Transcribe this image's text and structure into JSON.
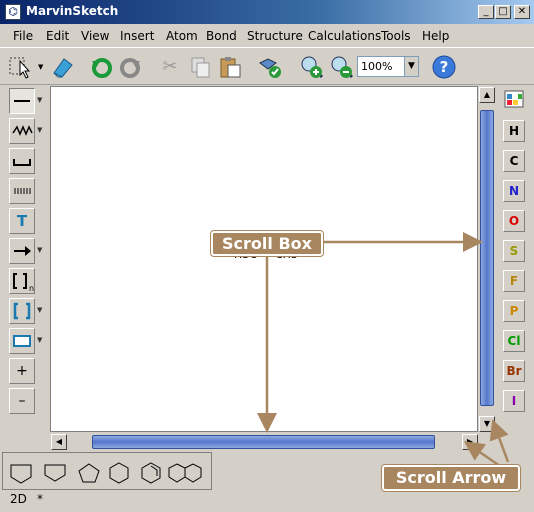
{
  "window": {
    "title": "MarvinSketch"
  },
  "menu": [
    "File",
    "Edit",
    "View",
    "Insert",
    "Atom",
    "Bond",
    "Structure",
    "Calculations",
    "Tools",
    "Help"
  ],
  "toolbar": {
    "zoom_value": "100%"
  },
  "canvas": {
    "molecule_label": "H3C — CH3"
  },
  "elements": [
    {
      "symbol": "H",
      "color": "#000000"
    },
    {
      "symbol": "C",
      "color": "#000000"
    },
    {
      "symbol": "N",
      "color": "#2222cc"
    },
    {
      "symbol": "O",
      "color": "#dd0000"
    },
    {
      "symbol": "S",
      "color": "#999900"
    },
    {
      "symbol": "F",
      "color": "#b8860b"
    },
    {
      "symbol": "P",
      "color": "#cc8800"
    },
    {
      "symbol": "Cl",
      "color": "#009900"
    },
    {
      "symbol": "Br",
      "color": "#993300"
    },
    {
      "symbol": "I",
      "color": "#8800aa"
    }
  ],
  "left_tools": {
    "text_tool": "T",
    "plus": "+",
    "minus": "–"
  },
  "status": {
    "mode": "2D",
    "modified": "*"
  },
  "callouts": {
    "scroll_box": "Scroll Box",
    "scroll_arrow": "Scroll Arrow"
  },
  "colors": {
    "callout": "#a88660",
    "scroll_thumb": "#5577cc"
  }
}
